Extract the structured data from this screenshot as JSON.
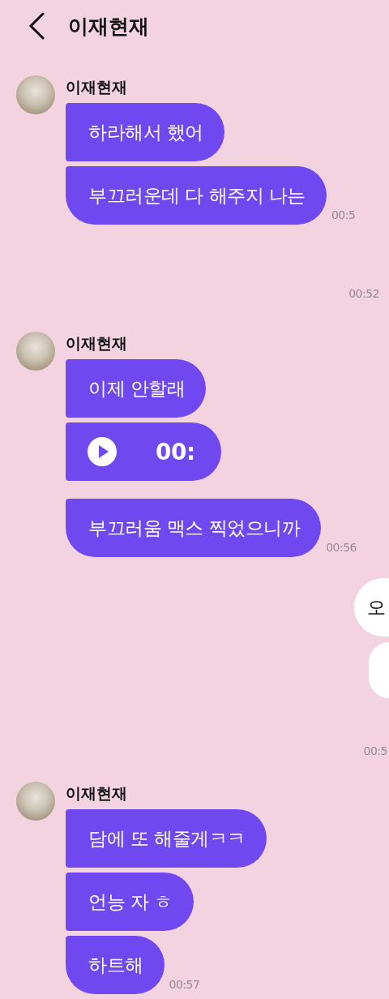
{
  "header": {
    "title": "이재현재"
  },
  "items": [
    {
      "kind": "incoming",
      "sender": "이재현재",
      "messages": [
        {
          "kind": "text",
          "text": "하라해서 했어"
        },
        {
          "kind": "text",
          "text": "부끄러운데 다 해주지 나는"
        }
      ],
      "time": "00:5"
    },
    {
      "kind": "timestamp",
      "time": "00:52"
    },
    {
      "kind": "incoming",
      "sender": "이재현재",
      "messages": [
        {
          "kind": "text",
          "text": "이제 안할래"
        },
        {
          "kind": "voice",
          "text": "00:"
        },
        {
          "kind": "text",
          "text": "부끄러움 맥스 찍었으니까"
        }
      ],
      "time": "00:56"
    },
    {
      "kind": "outgoing",
      "messages": [
        {
          "kind": "text",
          "text": "오"
        },
        {
          "kind": "blank"
        }
      ],
      "time": "00:5"
    },
    {
      "kind": "incoming",
      "sender": "이재현재",
      "messages": [
        {
          "kind": "text",
          "text": "담에 또 해줄게ㅋㅋ"
        },
        {
          "kind": "text",
          "text": "언능 자 ㅎ"
        },
        {
          "kind": "text",
          "text": "하트해"
        }
      ],
      "time": "00:57"
    }
  ]
}
